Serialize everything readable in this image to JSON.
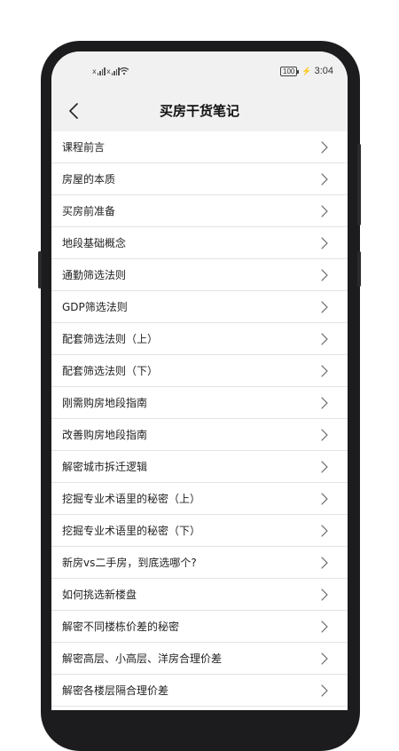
{
  "status_bar": {
    "time": "3:04",
    "battery": "100",
    "signal_label": "x"
  },
  "header": {
    "title": "买房干货笔记"
  },
  "list": {
    "items": [
      "课程前言",
      "房屋的本质",
      "买房前准备",
      "地段基础概念",
      "通勤筛选法则",
      "GDP筛选法则",
      "配套筛选法则（上）",
      "配套筛选法则（下）",
      "刚需购房地段指南",
      "改善购房地段指南",
      "解密城市拆迁逻辑",
      "挖掘专业术语里的秘密（上）",
      "挖掘专业术语里的秘密（下）",
      "新房vs二手房，到底选哪个?",
      "如何挑选新楼盘",
      "解密不同楼栋价差的秘密",
      "解密高层、小高层、洋房合理价差",
      "解密各楼层隔合理价差"
    ]
  }
}
